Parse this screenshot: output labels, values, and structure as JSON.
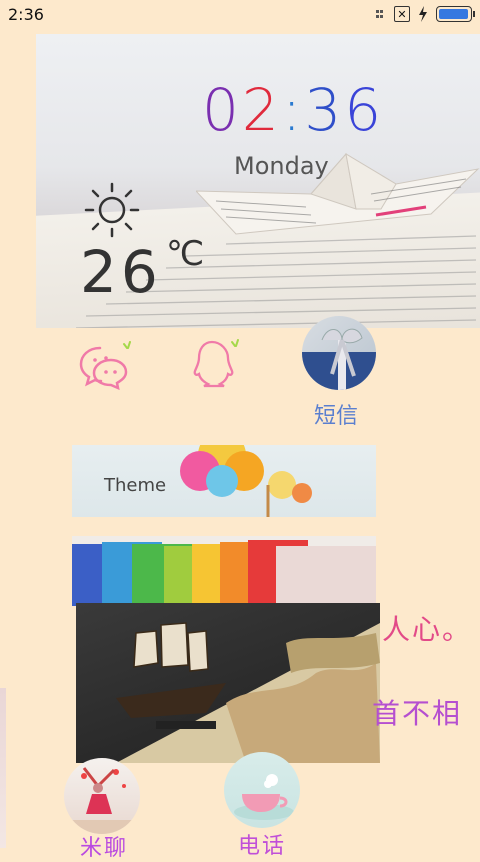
{
  "status_bar": {
    "time": "2:36",
    "battery_level": 0.95,
    "icons": [
      "signal-dots-icon",
      "no-sim-icon",
      "charging-bolt-icon",
      "battery-icon"
    ]
  },
  "widget": {
    "time": [
      "0",
      "2",
      ":",
      "3",
      "6"
    ],
    "day": "Monday",
    "temperature": "26",
    "temperature_unit": "℃",
    "weather_icon": "sun-icon"
  },
  "apps": {
    "wechat_icon": "wechat-icon",
    "qq_icon": "qq-penguin-icon",
    "sms_label": "短信",
    "theme_label": "Theme",
    "pink_text_1": "人心。",
    "pink_text_2": "首不相",
    "photos_label": "米聊",
    "phone_label": "电话"
  },
  "colors": {
    "background": "#fde9cc",
    "accent_pink": "#e24a88",
    "accent_purple": "#b54fd0",
    "accent_blue": "#5a7fcf"
  }
}
